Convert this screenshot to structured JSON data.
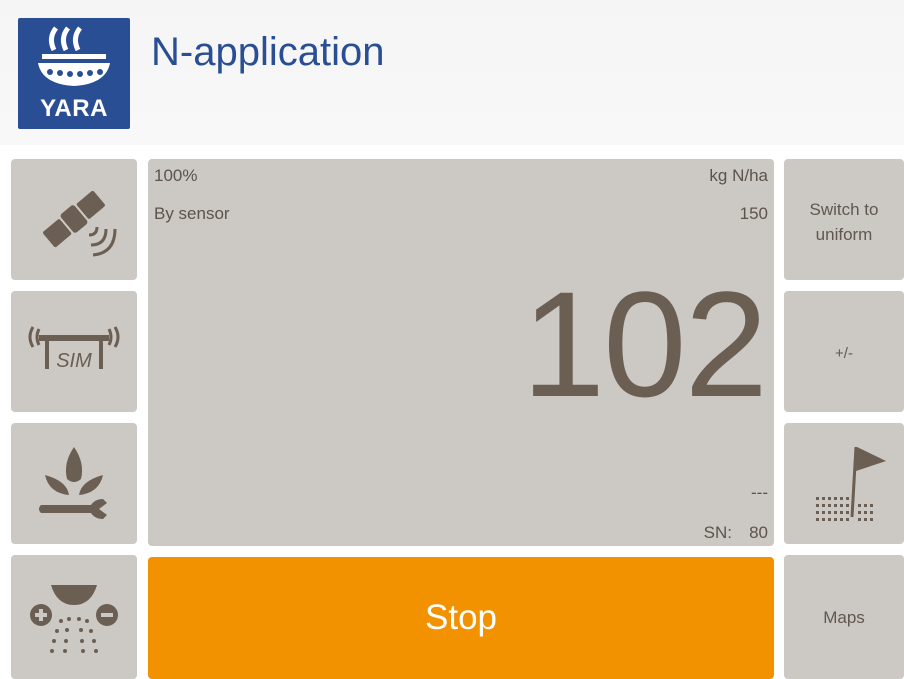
{
  "header": {
    "logo_text": "YARA",
    "title": "N-application"
  },
  "left_toolbar": [
    {
      "icon": "satellite-icon"
    },
    {
      "icon": "sim-sensor-icon",
      "icon_text": "SIM"
    },
    {
      "icon": "crop-settings-icon"
    },
    {
      "icon": "spreader-rate-icon"
    }
  ],
  "main_panel": {
    "percent": "100%",
    "unit": "kg N/ha",
    "mode": "By sensor",
    "target_value": "150",
    "current_rate": "102",
    "secondary_value": "---",
    "sn_label": "SN:",
    "sn_value": "80"
  },
  "right_toolbar": {
    "switch_label_line1": "Switch to",
    "switch_label_line2": "uniform",
    "plus_minus_label": "+/-",
    "headland_icon": "field-flag-icon",
    "maps_label": "Maps"
  },
  "stop_button": {
    "label": "Stop"
  },
  "colors": {
    "brand_blue": "#2a4e94",
    "tile_gray": "#ccc8c3",
    "icon_brown": "#6b5e52",
    "stop_orange": "#f39200"
  }
}
